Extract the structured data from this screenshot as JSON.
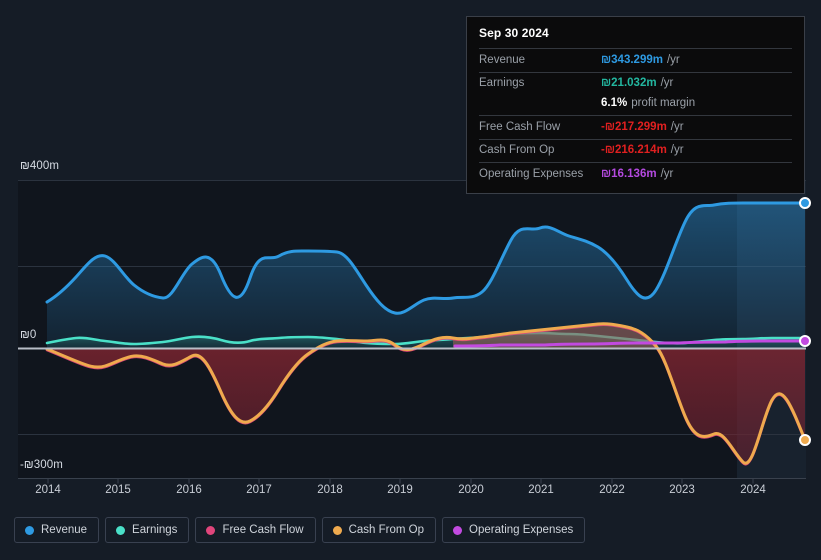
{
  "meta": {
    "background": "#151c26",
    "currency_symbol": "₪"
  },
  "tooltip": {
    "date": "Sep 30 2024",
    "rows": [
      {
        "key": "Revenue",
        "value": "₪343.299m",
        "unit": "/yr",
        "color": "#2e9ae2"
      },
      {
        "key": "Earnings",
        "value": "₪21.032m",
        "unit": "/yr",
        "color": "#23b7a0"
      },
      {
        "key": "Free Cash Flow",
        "value": "-₪217.299m",
        "unit": "/yr",
        "color": "#e02020"
      },
      {
        "key": "Cash From Op",
        "value": "-₪216.214m",
        "unit": "/yr",
        "color": "#e02020"
      },
      {
        "key": "Operating Expenses",
        "value": "₪16.136m",
        "unit": "/yr",
        "color": "#b44ae0"
      }
    ],
    "profit_margin_pct": "6.1%",
    "profit_margin_label": "profit margin"
  },
  "legend": {
    "items": [
      {
        "label": "Revenue",
        "color": "#2e9ae2"
      },
      {
        "label": "Earnings",
        "color": "#4ae0c8"
      },
      {
        "label": "Free Cash Flow",
        "color": "#e0457b"
      },
      {
        "label": "Cash From Op",
        "color": "#efaa4e"
      },
      {
        "label": "Operating Expenses",
        "color": "#c24ae0"
      }
    ]
  },
  "axes": {
    "y_ticks": [
      {
        "label": "₪400m",
        "value": 400
      },
      {
        "label": "₪0",
        "value": 0
      },
      {
        "label": "-₪300m",
        "value": -300
      }
    ],
    "x_ticks": [
      "2014",
      "2015",
      "2016",
      "2017",
      "2018",
      "2019",
      "2020",
      "2021",
      "2022",
      "2023",
      "2024"
    ]
  },
  "chart_data": {
    "type": "area",
    "title": "",
    "xlabel": "",
    "ylabel": "",
    "ylim": [
      -300,
      400
    ],
    "xlim": [
      2013.6,
      2024.95
    ],
    "grid": true,
    "legend_position": "bottom",
    "gridline_values": [
      400,
      200,
      0,
      -200
    ],
    "highlight_band": {
      "from": 2023.55,
      "to": 2024.95
    },
    "x": [
      2013.6,
      2013.85,
      2014.1,
      2014.35,
      2014.6,
      2014.85,
      2015.1,
      2015.35,
      2015.6,
      2015.85,
      2016.1,
      2016.35,
      2016.6,
      2016.85,
      2017.1,
      2017.35,
      2017.6,
      2017.85,
      2018.1,
      2018.35,
      2018.6,
      2018.85,
      2019.1,
      2019.35,
      2019.6,
      2019.85,
      2020.1,
      2020.35,
      2020.6,
      2020.85,
      2021.1,
      2021.35,
      2021.6,
      2021.85,
      2022.1,
      2022.35,
      2022.6,
      2022.85,
      2023.1,
      2023.35,
      2023.6,
      2023.85,
      2024.1,
      2024.35,
      2024.6,
      2024.75
    ],
    "series": [
      {
        "name": "Revenue",
        "color": "#2e9ae2",
        "fill": "rgba(46,154,226,0.22)",
        "values": [
          112,
          150,
          168,
          160,
          140,
          135,
          134,
          170,
          182,
          150,
          128,
          170,
          183,
          142,
          168,
          180,
          178,
          178,
          178,
          176,
          152,
          118,
          110,
          112,
          138,
          142,
          140,
          146,
          142,
          156,
          196,
          226,
          242,
          236,
          246,
          228,
          224,
          212,
          196,
          150,
          166,
          226,
          282,
          322,
          343,
          343
        ]
      },
      {
        "name": "Earnings",
        "color": "#4ae0c8",
        "fill": "rgba(74,224,200,0.22)",
        "values": [
          8,
          18,
          21,
          19,
          12,
          11,
          11,
          19,
          22,
          15,
          10,
          18,
          21,
          12,
          18,
          21,
          20,
          20,
          20,
          19,
          14,
          8,
          7,
          8,
          14,
          16,
          15,
          16,
          15,
          18,
          21,
          23,
          24,
          23,
          25,
          22,
          22,
          20,
          18,
          12,
          14,
          18,
          20,
          21,
          21,
          21
        ]
      },
      {
        "name": "Free Cash Flow",
        "color": "#e0457b",
        "fill": "rgba(224,69,123,0.20)",
        "values": [
          -4,
          -14,
          -22,
          -32,
          -42,
          -52,
          -44,
          -30,
          -28,
          -36,
          -58,
          -44,
          -30,
          -48,
          -110,
          -170,
          -195,
          -182,
          -146,
          -92,
          -44,
          -10,
          -2,
          -12,
          -24,
          4,
          48,
          66,
          62,
          32,
          22,
          56,
          92,
          112,
          132,
          148,
          150,
          134,
          96,
          -42,
          -132,
          -196,
          -214,
          -120,
          -218,
          -217
        ]
      },
      {
        "name": "Cash From Op",
        "color": "#efaa4e",
        "fill": "rgba(239,170,78,0.22)",
        "values": [
          -2,
          -12,
          -20,
          -30,
          -40,
          -50,
          -42,
          -28,
          -26,
          -34,
          -56,
          -42,
          -28,
          -46,
          -108,
          -168,
          -193,
          -180,
          -144,
          -90,
          -42,
          -8,
          0,
          -10,
          -22,
          6,
          50,
          68,
          64,
          34,
          24,
          58,
          94,
          114,
          134,
          150,
          152,
          136,
          98,
          -40,
          -130,
          -194,
          -212,
          -118,
          -216,
          -216
        ]
      },
      {
        "name": "Operating Expenses",
        "color": "#c24ae0",
        "fill": "rgba(194,74,224,0.00)",
        "start_index": 24,
        "values": [
          null,
          null,
          null,
          null,
          null,
          null,
          null,
          null,
          null,
          null,
          null,
          null,
          null,
          null,
          null,
          null,
          null,
          null,
          null,
          null,
          null,
          null,
          null,
          null,
          -6,
          -6,
          -6,
          -6,
          -6,
          -6,
          -5,
          -5,
          -5,
          -4,
          -4,
          -4,
          -4,
          -4,
          -3,
          -2,
          2,
          8,
          12,
          14,
          16,
          16
        ]
      }
    ],
    "endpoint_markers": [
      {
        "series": "Revenue",
        "value": 343,
        "color": "#2e9ae2"
      },
      {
        "series": "Operating Expenses",
        "value": 16,
        "color": "#c24ae0"
      },
      {
        "series": "Cash From Op",
        "value": -216,
        "color": "#efaa4e"
      }
    ]
  }
}
